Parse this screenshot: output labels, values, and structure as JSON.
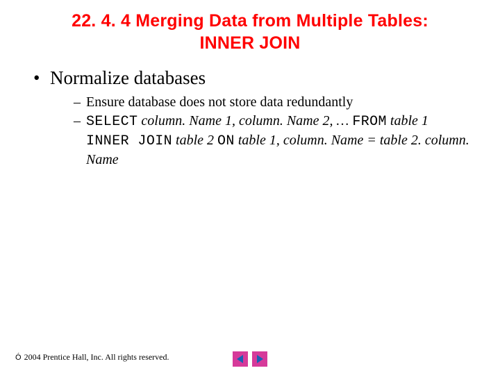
{
  "title_line1": "22. 4. 4 Merging Data from Multiple Tables:",
  "title_line2": "INNER JOIN",
  "bullet1": "Normalize databases",
  "sub1": "Ensure database does not store data redundantly",
  "sql": {
    "select": "SELECT",
    "col1": "column. Name 1",
    "sep1": ", ",
    "col2": "column. Name 2",
    "sep2": ", … ",
    "from": "FROM",
    "tbl1": " table 1 ",
    "ij": "INNER JOIN",
    "tbl2": " table 2 ",
    "on": "ON",
    "onexpr": " table 1, column. Name = table 2. column. Name"
  },
  "footer_copy": "Ó",
  "footer_text": " 2004 Prentice Hall, Inc.  All rights reserved.",
  "nav": {
    "back": "back-button",
    "fwd": "forward-button"
  }
}
